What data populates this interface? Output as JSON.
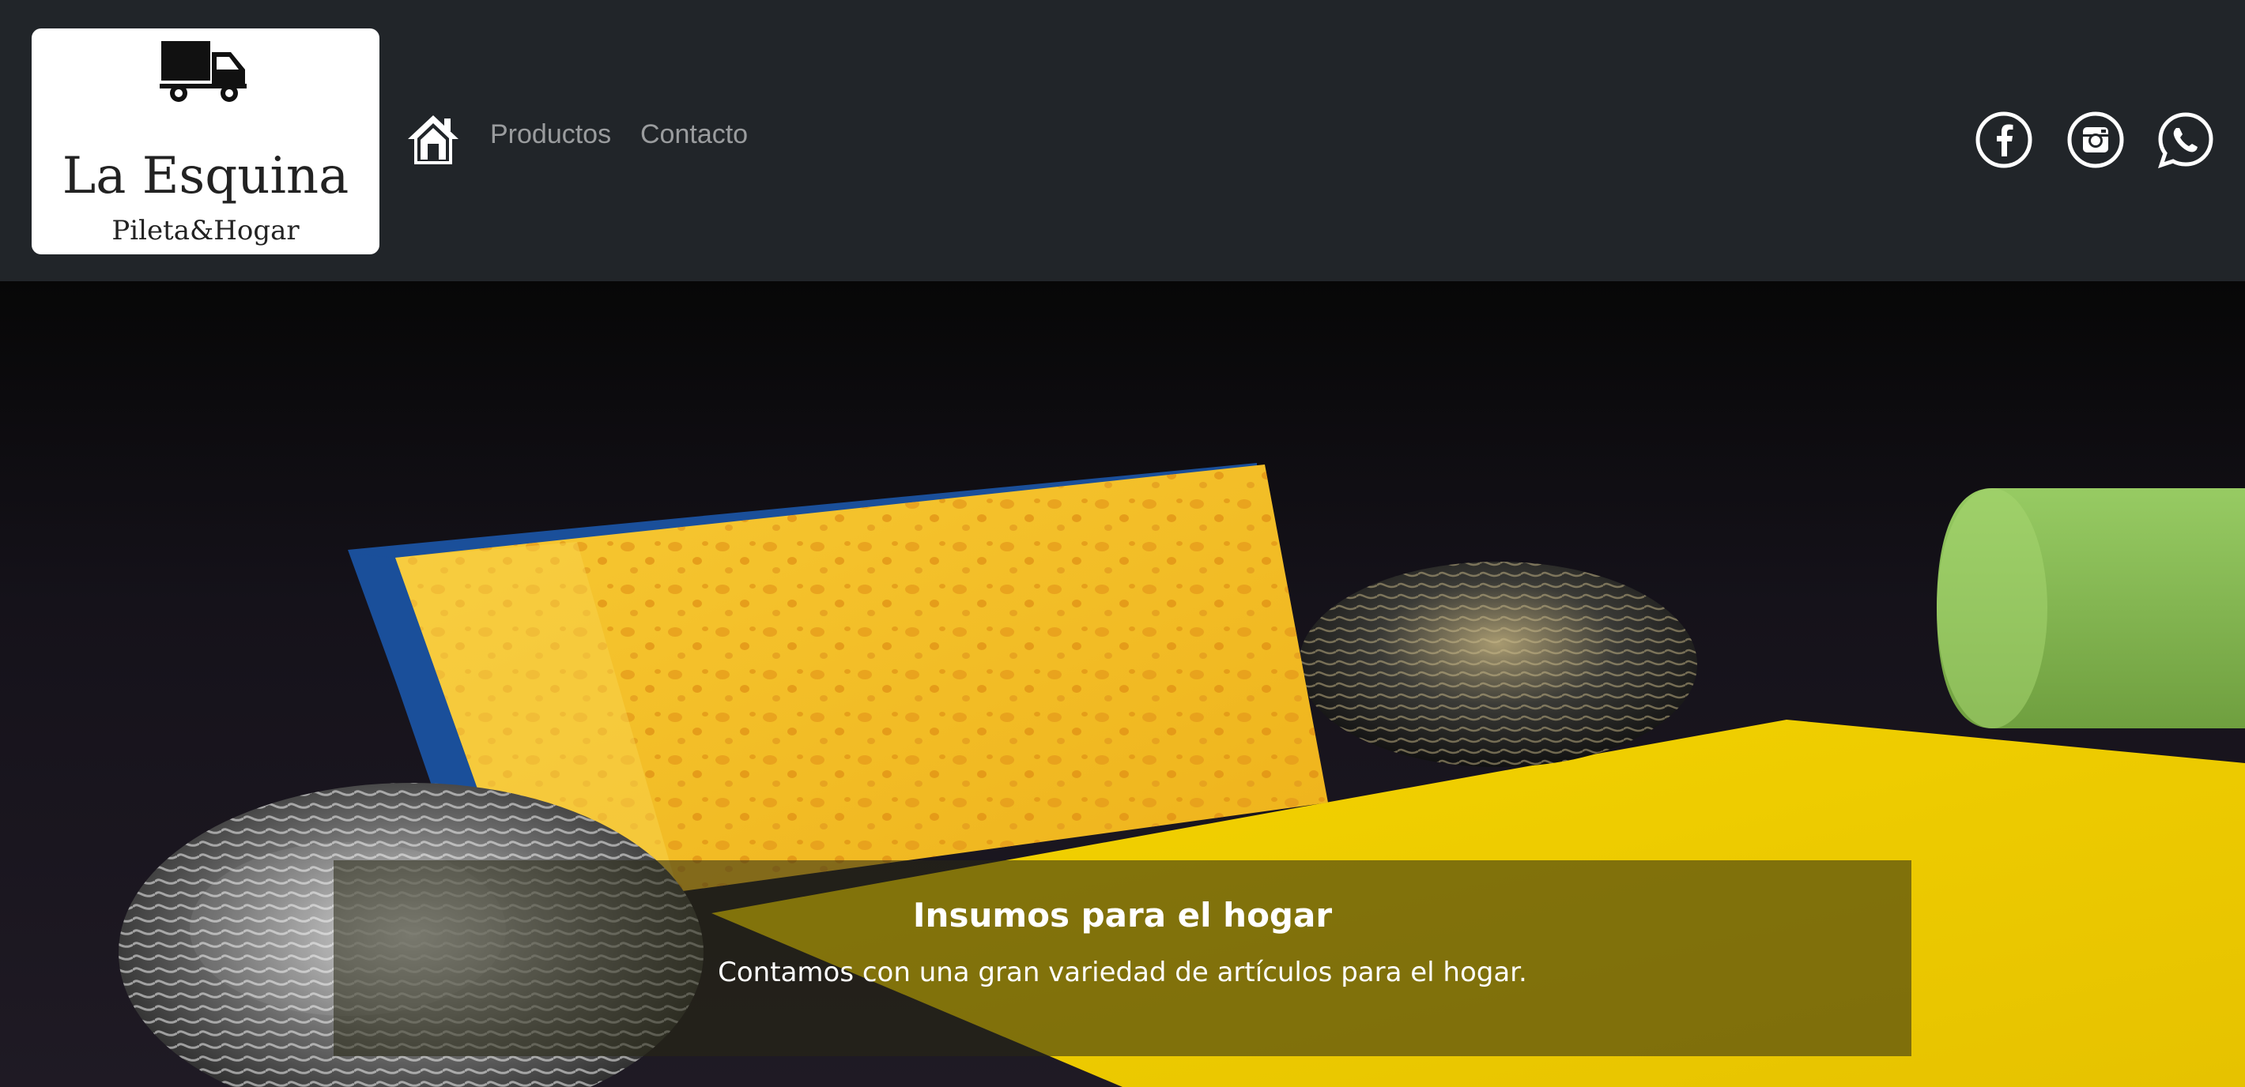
{
  "brand": {
    "title": "La Esquina",
    "subtitle": "Pileta&Hogar",
    "icon": "truck-icon"
  },
  "nav": {
    "home_icon": "home-icon",
    "items": [
      {
        "label": "Productos"
      },
      {
        "label": "Contacto"
      }
    ]
  },
  "social": [
    {
      "icon": "facebook-icon"
    },
    {
      "icon": "instagram-icon"
    },
    {
      "icon": "whatsapp-icon"
    }
  ],
  "hero": {
    "caption_title": "Insumos para el hogar",
    "caption_text": "Contamos con una gran variedad de artículos para el hogar."
  },
  "colors": {
    "navbar_bg": "#212529",
    "nav_link": "#a6a8aa",
    "sponge_yellow": "#f2c21b",
    "sponge_blue": "#1a4f9a",
    "cloth_yellow": "#f3d200",
    "roll_green": "#8cc157"
  }
}
